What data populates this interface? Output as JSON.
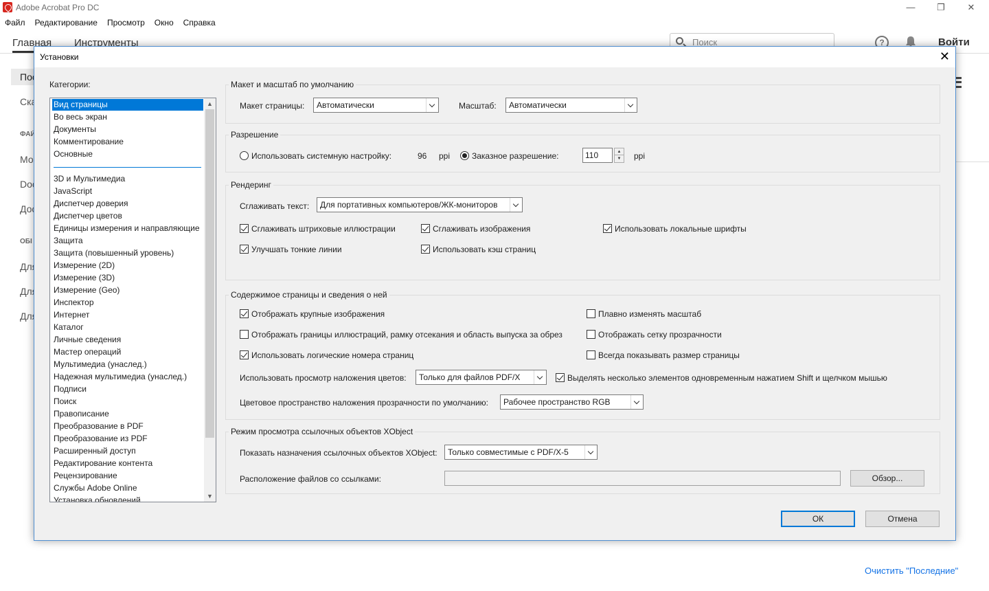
{
  "app": {
    "title": "Adobe Acrobat Pro DC",
    "window_controls": {
      "minimize": "—",
      "maximize": "❐",
      "close": "✕"
    },
    "menu": [
      "Файл",
      "Редактирование",
      "Просмотр",
      "Окно",
      "Справка"
    ],
    "tabs": [
      "Главная",
      "Инструменты"
    ],
    "search_placeholder": "Поиск",
    "sign_in": "Войти",
    "left_panel": [
      "Пос",
      "Ска",
      "ФАЙ",
      "Мо",
      "Doc",
      "Доc",
      "ОБІ",
      "Для",
      "Для",
      "Для"
    ],
    "clear_recent": "Очистить \"Последние\""
  },
  "dialog": {
    "title": "Установки",
    "close_glyph": "✕",
    "categories_label": "Категории:",
    "categories_top": [
      "Вид страницы",
      "Во весь экран",
      "Документы",
      "Комментирование",
      "Основные"
    ],
    "categories_rest": [
      "3D и Мультимедиа",
      "JavaScript",
      "Диспетчер доверия",
      "Диспетчер цветов",
      "Единицы измерения и направляющие",
      "Защита",
      "Защита (повышенный уровень)",
      "Измерение (2D)",
      "Измерение (3D)",
      "Измерение (Geo)",
      "Инспектор",
      "Интернет",
      "Каталог",
      "Личные сведения",
      "Мастер операций",
      "Мультимедиа (унаслед.)",
      "Надежная мультимедиа (унаслед.)",
      "Подписи",
      "Поиск",
      "Правописание",
      "Преобразование в PDF",
      "Преобразование из PDF",
      "Расширенный доступ",
      "Редактирование контента",
      "Рецензирование",
      "Службы Adobe Online",
      "Установка обновлений"
    ],
    "layout": {
      "legend": "Макет и масштаб по умолчанию",
      "page_layout_label": "Макет страницы:",
      "page_layout_value": "Автоматически",
      "zoom_label": "Масштаб:",
      "zoom_value": "Автоматически"
    },
    "resolution": {
      "legend": "Разрешение",
      "system_label": "Использовать системную настройку:",
      "system_value": "96",
      "system_unit": "ppi",
      "custom_label": "Заказное разрешение:",
      "custom_value": "110",
      "custom_unit": "ppi"
    },
    "rendering": {
      "legend": "Рендеринг",
      "smooth_text_label": "Сглаживать текст:",
      "smooth_text_value": "Для портативных компьютеров/ЖК-мониторов",
      "cb_line_art": "Сглаживать штриховые иллюстрации",
      "cb_images": "Сглаживать изображения",
      "cb_local_fonts": "Использовать локальные шрифты",
      "cb_thin_lines": "Улучшать тонкие линии",
      "cb_page_cache": "Использовать кэш страниц"
    },
    "content": {
      "legend": "Содержимое страницы и сведения о ней",
      "cb_large_images": "Отображать крупные изображения",
      "cb_smooth_zoom": "Плавно изменять масштаб",
      "cb_art_boxes": "Отображать границы иллюстраций, рамку отсекания и область выпуска за обрез",
      "cb_transparency_grid": "Отображать сетку прозрачности",
      "cb_logical_numbers": "Использовать логические номера страниц",
      "cb_page_size": "Всегда показывать размер страницы",
      "overprint_label": "Использовать просмотр наложения цветов:",
      "overprint_value": "Только для файлов PDF/X",
      "cb_shift_click": "Выделять несколько элементов одновременным нажатием Shift и щелчком мышью",
      "blend_label": "Цветовое пространство наложения прозрачности по умолчанию:",
      "blend_value": "Рабочее пространство RGB"
    },
    "xobject": {
      "legend": "Режим просмотра ссылочных объектов XObject",
      "show_targets_label": "Показать назначения ссылочных объектов XObject:",
      "show_targets_value": "Только совместимые с PDF/X-5",
      "files_location_label": "Расположение файлов со ссылками:",
      "files_location_value": "",
      "browse_button": "Обзор..."
    },
    "ok_button": "ОК",
    "cancel_button": "Отмена"
  }
}
